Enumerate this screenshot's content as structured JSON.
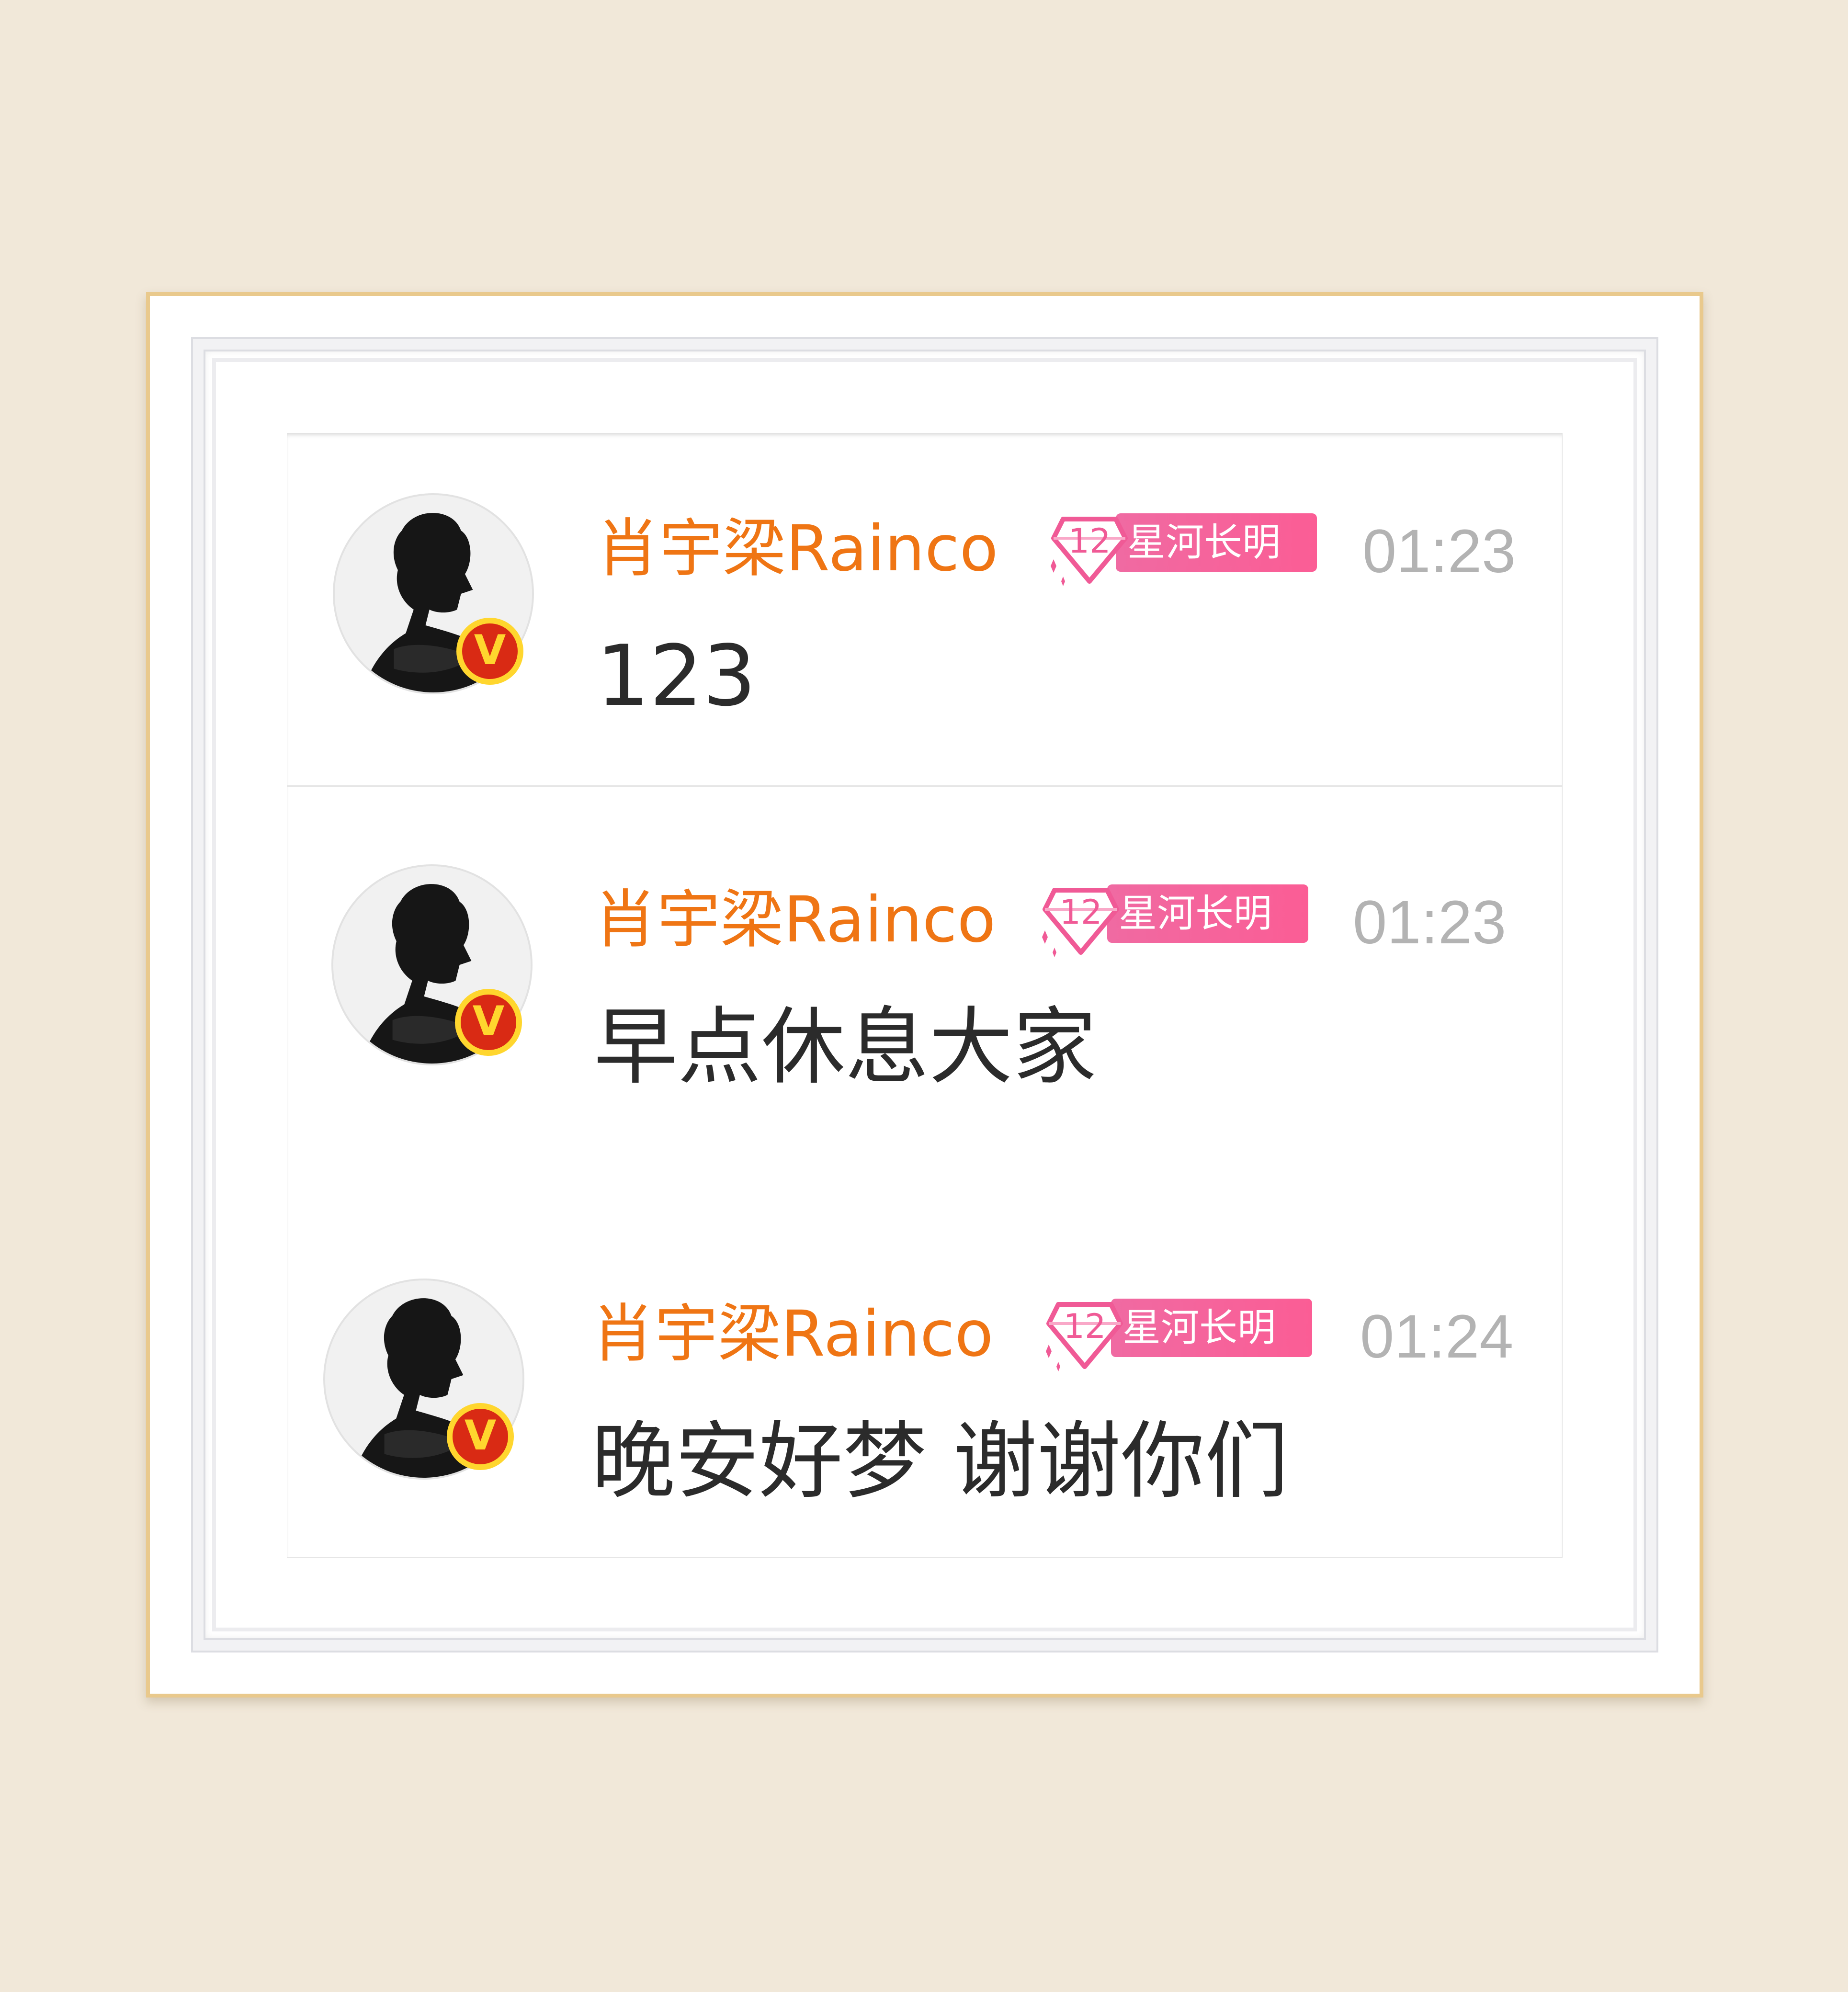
{
  "background_color": "#f1e8d9",
  "frame_border_color": "#e9c98c",
  "name_color": "#ef7514",
  "badge_color": "#f86a9f",
  "time_color": "#b3b3b3",
  "messages": [
    {
      "author": "肖宇梁Rainco",
      "verified_mark": "V",
      "fan_level": "12",
      "fan_badge_text": "星河长明",
      "time": "01:23",
      "text": "123"
    },
    {
      "author": "肖宇梁Rainco",
      "verified_mark": "V",
      "fan_level": "12",
      "fan_badge_text": "星河长明",
      "time": "01:23",
      "text": "早点休息大家"
    },
    {
      "author": "肖宇梁Rainco",
      "verified_mark": "V",
      "fan_level": "12",
      "fan_badge_text": "星河长明",
      "time": "01:24",
      "text": "晚安好梦 谢谢你们"
    }
  ]
}
